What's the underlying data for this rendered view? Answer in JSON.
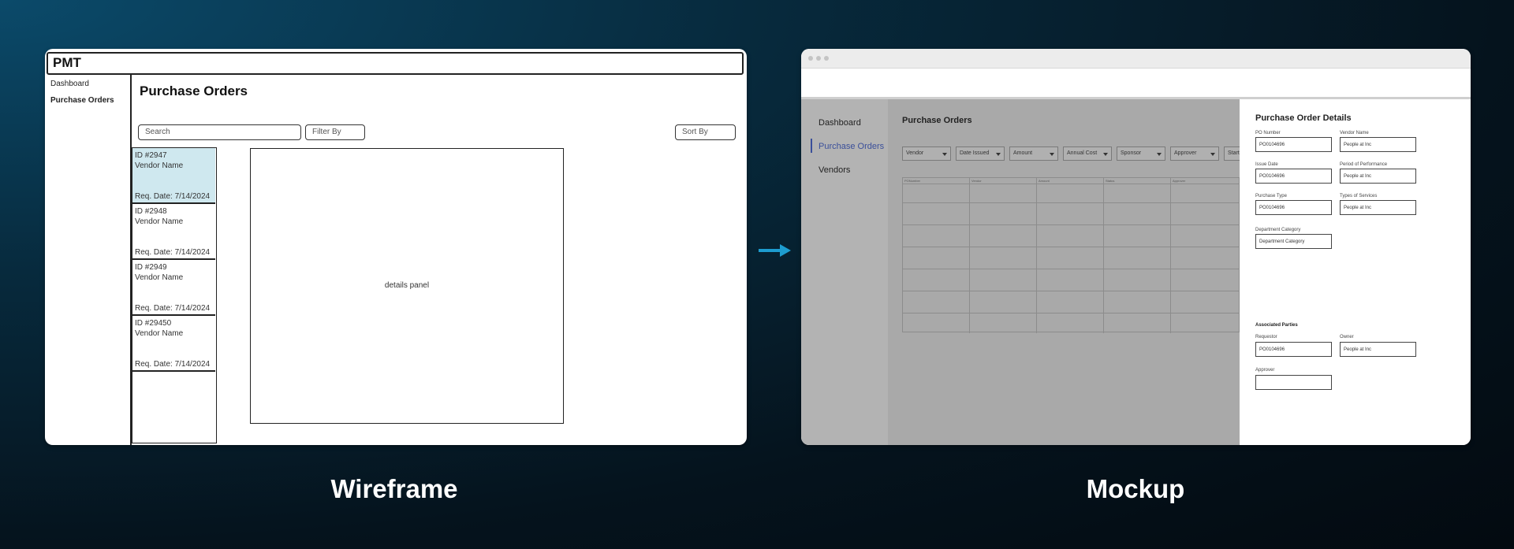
{
  "wireframe": {
    "app_title": "PMT",
    "nav": [
      "Dashboard",
      "Purchase Orders"
    ],
    "page_title": "Purchase Orders",
    "search_placeholder": "Search",
    "filter_label": "Filter By",
    "sort_label": "Sort By",
    "orders": [
      {
        "id": "ID #2947",
        "vendor": "Vendor Name",
        "date": "Req. Date: 7/14/2024",
        "selected": true
      },
      {
        "id": "ID #2948",
        "vendor": "Vendor Name",
        "date": "Req. Date: 7/14/2024",
        "selected": false
      },
      {
        "id": "ID #2949",
        "vendor": "Vendor Name",
        "date": "Req. Date: 7/14/2024",
        "selected": false
      },
      {
        "id": "ID #29450",
        "vendor": "Vendor Name",
        "date": "Req. Date: 7/14/2024",
        "selected": false
      }
    ],
    "details_placeholder": "details panel",
    "caption": "Wireframe"
  },
  "mockup": {
    "nav": [
      "Dashboard",
      "Purchase Orders",
      "Vendors"
    ],
    "active_nav": "Purchase Orders",
    "page_title": "Purchase Orders",
    "filters": [
      "Vendor",
      "Date Issued",
      "Amount",
      "Annual Cost",
      "Sponsor",
      "Approver",
      "Start"
    ],
    "table_headers": [
      "PONumber",
      "Vendor",
      "Amount",
      "Status",
      "Approver"
    ],
    "details": {
      "title": "Purchase Order Details",
      "fields": [
        {
          "label": "PO Number",
          "value": "PO0104696"
        },
        {
          "label": "Vendor Name",
          "value": "People at Inc"
        },
        {
          "label": "Issue Date",
          "value": "PO0104696"
        },
        {
          "label": "Period of Performance",
          "value": "People at Inc"
        },
        {
          "label": "Purchase Type",
          "value": "PO0104696"
        },
        {
          "label": "Types of Services",
          "value": "People at Inc"
        },
        {
          "label": "Department Category",
          "value": "Department Category"
        }
      ],
      "associated_title": "Associated Parties",
      "parties": [
        {
          "label": "Requestor",
          "value": "PO0104696"
        },
        {
          "label": "Owner",
          "value": "People at Inc"
        },
        {
          "label": "Approver",
          "value": ""
        }
      ]
    },
    "caption": "Mockup"
  },
  "colors": {
    "accent_arrow": "#1d9ccf",
    "selected_item": "#cfe8ef",
    "mockup_active_nav": "#3a4f9a"
  }
}
